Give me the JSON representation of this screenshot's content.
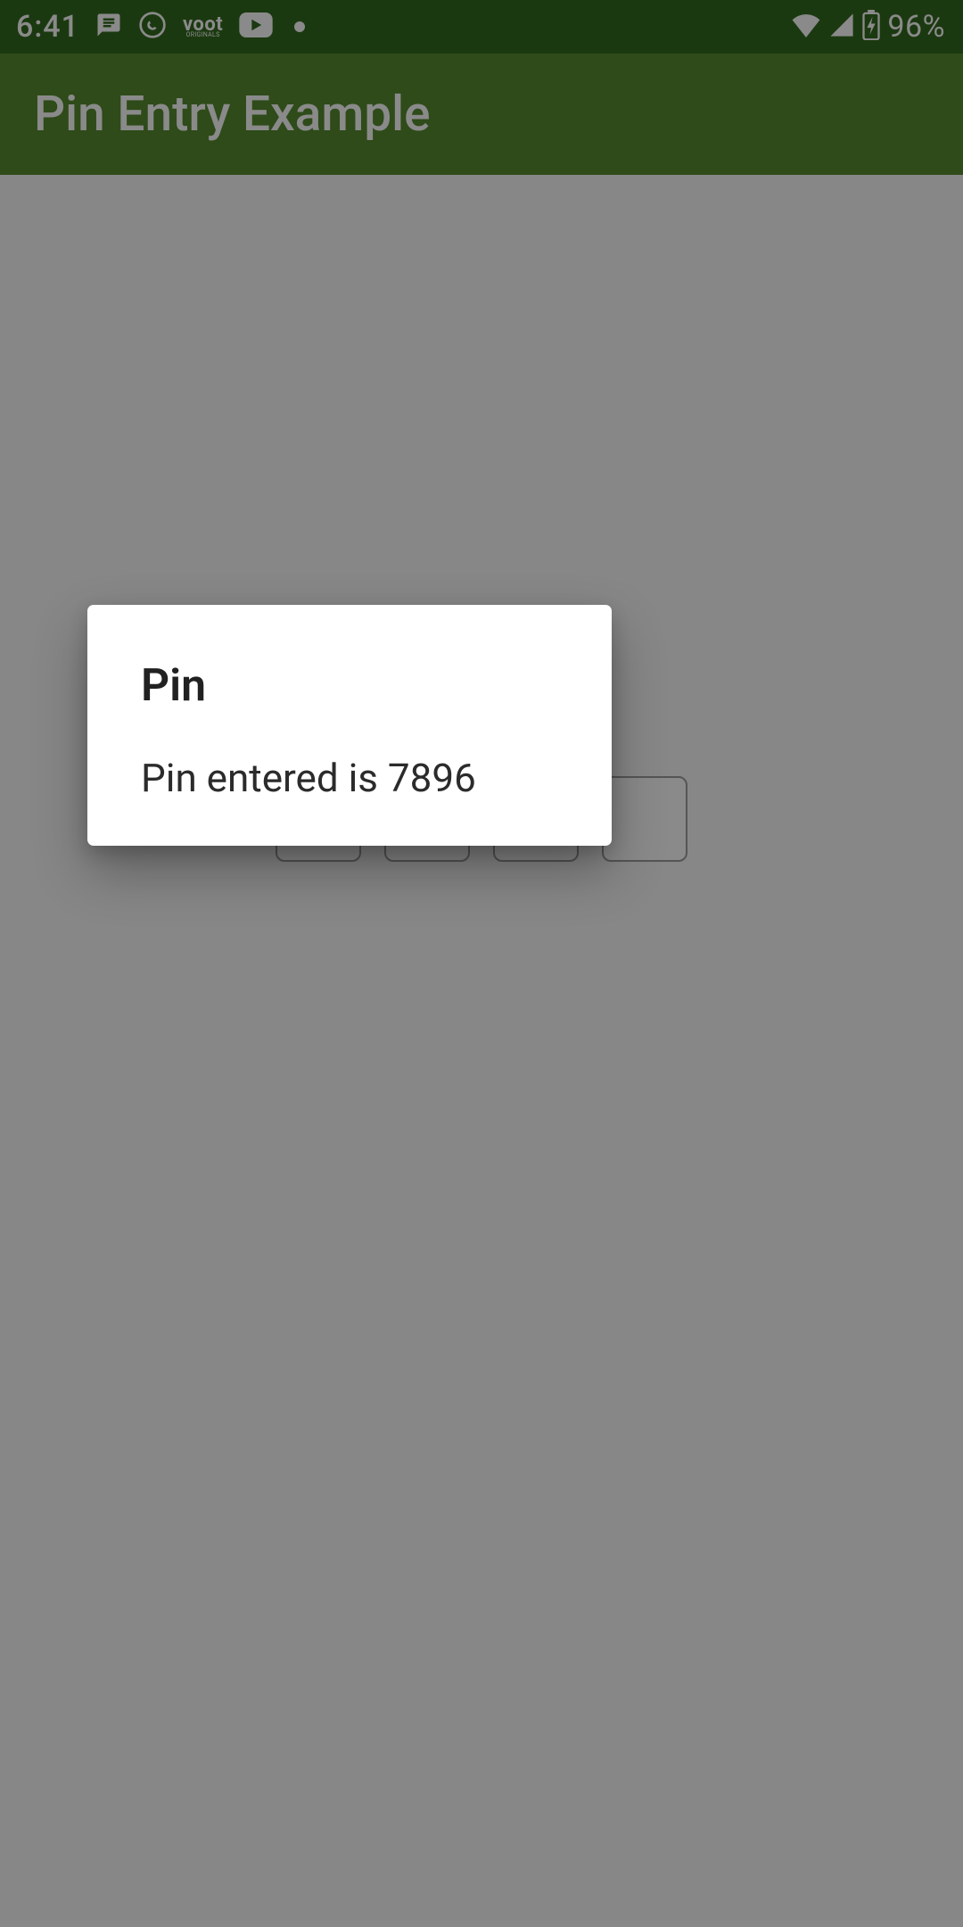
{
  "status": {
    "time": "6:41",
    "icons": {
      "msg": "message-square-icon",
      "whatsapp": "whatsapp-icon",
      "voot": "voot",
      "voot_sub": "ORIGINALS",
      "youtube": "youtube-icon",
      "dot": "dot-icon",
      "wifi": "wifi-icon",
      "cell": "cellular-icon",
      "battery": "battery-charging-icon"
    },
    "battery_pct": "96%"
  },
  "appbar": {
    "title": "Pin Entry Example"
  },
  "pin_boxes": [
    "",
    "",
    "",
    ""
  ],
  "dialog": {
    "title": "Pin",
    "message": "Pin entered is 7896"
  }
}
